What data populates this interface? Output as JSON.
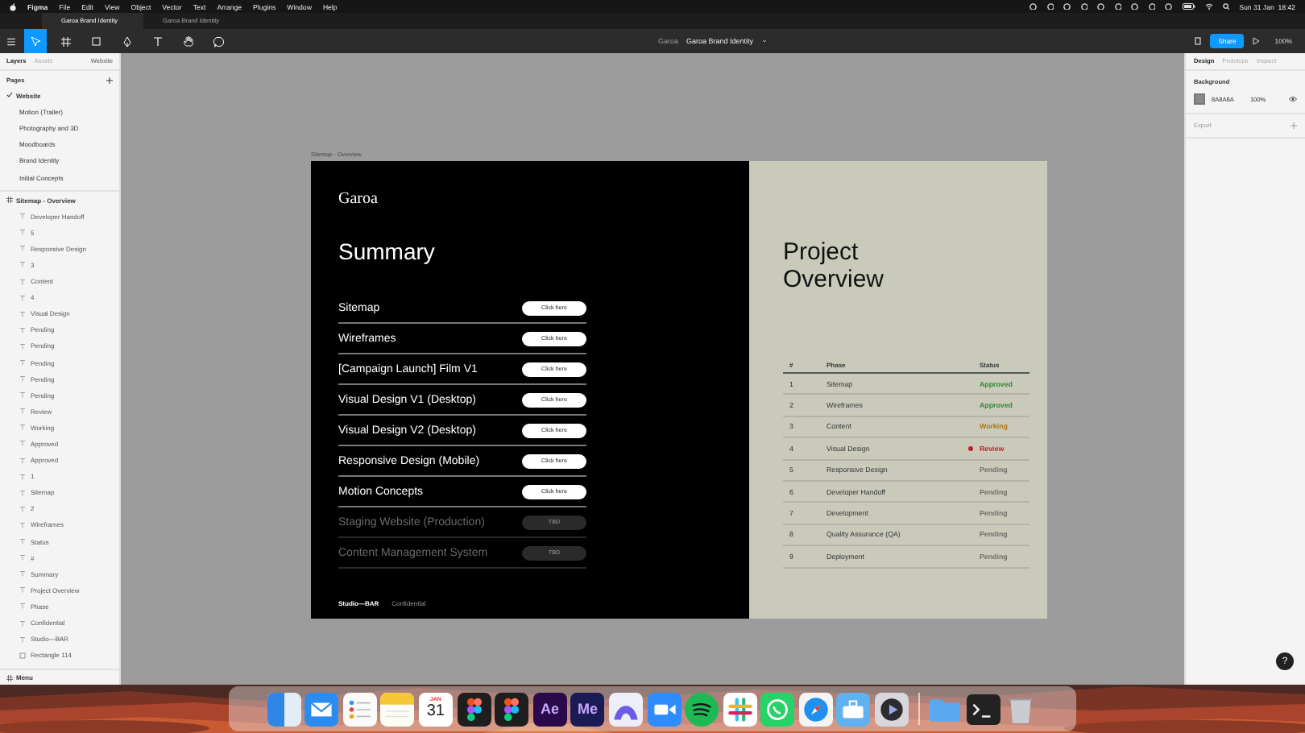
{
  "menubar": {
    "app": "Figma",
    "items": [
      "File",
      "Edit",
      "View",
      "Object",
      "Vector",
      "Text",
      "Arrange",
      "Plugins",
      "Window",
      "Help"
    ],
    "clock": "Sun 31 Jan  18:42"
  },
  "tabs": [
    {
      "label": "Garoa Brand Identity",
      "selected": true
    },
    {
      "label": "Garoa Brand Identity",
      "selected": false
    }
  ],
  "toolbar": {
    "tools": [
      {
        "kind": "move",
        "selected": true
      },
      {
        "kind": "frame",
        "selected": false
      },
      {
        "kind": "shape",
        "selected": false
      },
      {
        "kind": "pen",
        "selected": false
      },
      {
        "kind": "text",
        "selected": false
      },
      {
        "kind": "hand",
        "selected": false
      },
      {
        "kind": "comment",
        "selected": false
      }
    ],
    "project": "Garoa",
    "file": "Garoa Brand Identity",
    "share": "Share",
    "zoom": "100%"
  },
  "layers_panel": {
    "tabs": [
      {
        "label": "Layers",
        "selected": true
      },
      {
        "label": "Assets",
        "selected": false
      }
    ],
    "page_selector": "Website",
    "pages_title": "Pages",
    "pages": [
      {
        "label": "Website",
        "selected": true
      },
      {
        "label": "Motion (Trailer)",
        "selected": false
      },
      {
        "label": "Photography and 3D",
        "selected": false
      },
      {
        "label": "Moodboards",
        "selected": false
      },
      {
        "label": "Brand Identity",
        "selected": false
      },
      {
        "label": "Initial Concepts",
        "selected": false
      }
    ],
    "frame": {
      "name": "Sitemap - Overview",
      "layers": [
        {
          "kind": "text",
          "label": "Developer Handoff"
        },
        {
          "kind": "text",
          "label": "5"
        },
        {
          "kind": "text",
          "label": "Responsive Design"
        },
        {
          "kind": "text",
          "label": "3"
        },
        {
          "kind": "text",
          "label": "Content"
        },
        {
          "kind": "text",
          "label": "4"
        },
        {
          "kind": "text",
          "label": "Visual Design"
        },
        {
          "kind": "text",
          "label": "Pending"
        },
        {
          "kind": "text",
          "label": "Pending"
        },
        {
          "kind": "text",
          "label": "Pending"
        },
        {
          "kind": "text",
          "label": "Pending"
        },
        {
          "kind": "text",
          "label": "Pending"
        },
        {
          "kind": "text",
          "label": "Review"
        },
        {
          "kind": "text",
          "label": "Working"
        },
        {
          "kind": "text",
          "label": "Approved"
        },
        {
          "kind": "text",
          "label": "Approved"
        },
        {
          "kind": "text",
          "label": "1"
        },
        {
          "kind": "text",
          "label": "Sitemap"
        },
        {
          "kind": "text",
          "label": "2"
        },
        {
          "kind": "text",
          "label": "Wireframes"
        },
        {
          "kind": "text",
          "label": "Status"
        },
        {
          "kind": "text",
          "label": "#"
        },
        {
          "kind": "text",
          "label": "Summary"
        },
        {
          "kind": "text",
          "label": "Project Overview"
        },
        {
          "kind": "text",
          "label": "Phase"
        },
        {
          "kind": "text",
          "label": "Confidential"
        },
        {
          "kind": "text",
          "label": "Studio—BAR"
        },
        {
          "kind": "rect",
          "label": "Rectangle 114"
        }
      ]
    },
    "bottom_frame": "Menu"
  },
  "canvas": {
    "frame_label": "Sitemap - Overview",
    "summary": {
      "logo": "Garoa",
      "title": "Summary",
      "rows": [
        {
          "label": "Sitemap",
          "button": "Click here",
          "faded": false
        },
        {
          "label": "Wireframes",
          "button": "Click here",
          "faded": false
        },
        {
          "label": "[Campaign Launch] Film V1",
          "button": "Click here",
          "faded": false
        },
        {
          "label": "Visual Design V1 (Desktop)",
          "button": "Click here",
          "faded": false
        },
        {
          "label": "Visual Design V2 (Desktop)",
          "button": "Click here",
          "faded": false
        },
        {
          "label": "Responsive Design (Mobile)",
          "button": "Click here",
          "faded": false
        },
        {
          "label": "Motion Concepts",
          "button": "Click here",
          "faded": false
        },
        {
          "label": "Staging Website (Production)",
          "button": "TBD",
          "faded": true
        },
        {
          "label": "Content Management System",
          "button": "TBD",
          "faded": true
        }
      ],
      "brand": "Studio—BAR",
      "note": "Confidential"
    },
    "overview": {
      "title": "Project Overview",
      "columns": [
        "#",
        "Phase",
        "Status"
      ],
      "rows": [
        {
          "num": "1",
          "phase": "Sitemap",
          "status": "Approved",
          "color": "#2f8a36",
          "marked": false
        },
        {
          "num": "2",
          "phase": "Wireframes",
          "status": "Approved",
          "color": "#2f8a36",
          "marked": false
        },
        {
          "num": "3",
          "phase": "Content",
          "status": "Working",
          "color": "#b0741a",
          "marked": false
        },
        {
          "num": "4",
          "phase": "Visual Design",
          "status": "Review",
          "color": "#c01f30",
          "marked": true
        },
        {
          "num": "5",
          "phase": "Responsive Design",
          "status": "Pending",
          "color": "#6f6f68",
          "marked": false
        },
        {
          "num": "6",
          "phase": "Developer Handoff",
          "status": "Pending",
          "color": "#6f6f68",
          "marked": false
        },
        {
          "num": "7",
          "phase": "Development",
          "status": "Pending",
          "color": "#6f6f68",
          "marked": false
        },
        {
          "num": "8",
          "phase": "Quality Assurance (QA)",
          "status": "Pending",
          "color": "#6f6f68",
          "marked": false
        },
        {
          "num": "9",
          "phase": "Deployment",
          "status": "Pending",
          "color": "#6f6f68",
          "marked": false
        }
      ]
    }
  },
  "design_panel": {
    "tabs": [
      {
        "label": "Design",
        "selected": true
      },
      {
        "label": "Prototype",
        "selected": false
      },
      {
        "label": "Inspect",
        "selected": false
      }
    ],
    "background": {
      "label": "Background",
      "hex": "8A8A8A",
      "opacity": "100%"
    },
    "export": "Export",
    "help": "?"
  },
  "dock": [
    {
      "kind": "split"
    },
    {
      "kind": "envelope"
    },
    {
      "kind": "list"
    },
    {
      "kind": "notepad"
    },
    {
      "kind": "calendar",
      "month": "JAN",
      "day": "31"
    },
    {
      "kind": "figma"
    },
    {
      "kind": "figma"
    },
    {
      "kind": "letters",
      "label": "Ae",
      "color": "#2a0a4a"
    },
    {
      "kind": "letters",
      "label": "Me",
      "color": "#1a1a55"
    },
    {
      "kind": "arch"
    },
    {
      "kind": "camera"
    },
    {
      "kind": "sound"
    },
    {
      "kind": "hash"
    },
    {
      "kind": "phone"
    },
    {
      "kind": "compass"
    },
    {
      "kind": "toolbox"
    },
    {
      "kind": "playcircle"
    },
    {
      "kind": "separator"
    },
    {
      "kind": "folder"
    },
    {
      "kind": "terminal"
    },
    {
      "kind": "trash"
    }
  ]
}
